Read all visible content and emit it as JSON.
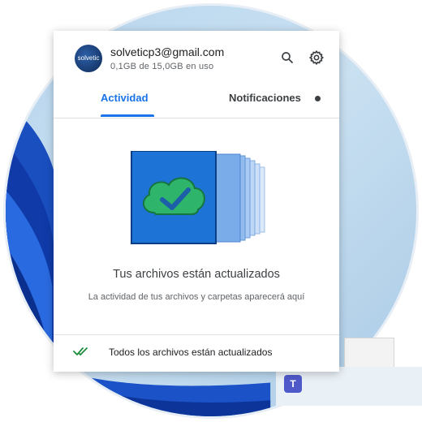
{
  "account": {
    "email": "solveticp3@gmail.com",
    "storage_usage": "0,1GB de 15,0GB en uso",
    "avatar_text": "solvetic"
  },
  "tabs": [
    {
      "label": "Actividad",
      "active": true
    },
    {
      "label": "Notificaciones",
      "active": false,
      "has_dot": true
    }
  ],
  "empty_state": {
    "title": "Tus archivos están actualizados",
    "subtitle": "La actividad de tus archivos y carpetas aparecerá aquí"
  },
  "footer": {
    "status": "Todos los archivos están actualizados"
  },
  "taskbar": {
    "teams_glyph": "T"
  },
  "icons": {
    "search": "search-icon",
    "settings": "gear-icon",
    "status": "double-check-icon"
  },
  "colors": {
    "accent": "#1a73e8",
    "check": "#1e8e3e",
    "cloud": "#2fb56b",
    "folder": "#1d74d6"
  }
}
